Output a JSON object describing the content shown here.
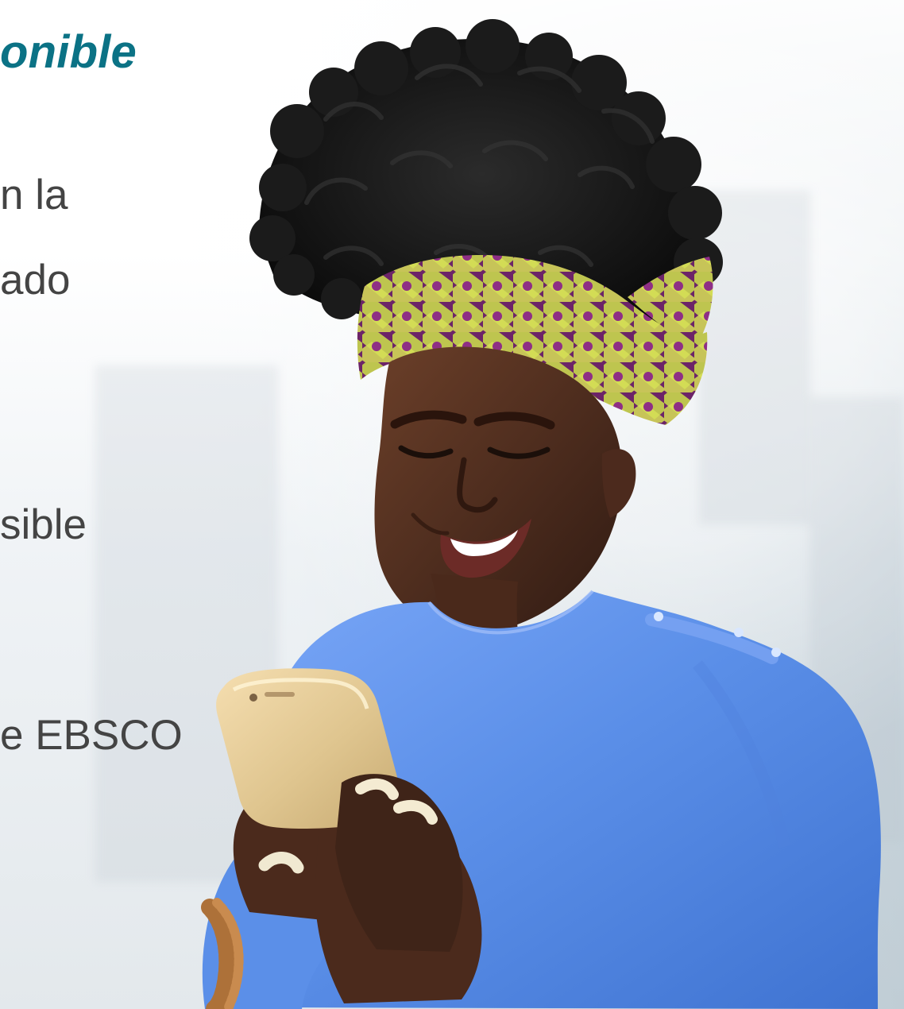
{
  "slide": {
    "title_fragment": "onible",
    "text_fragments": [
      "n la",
      "ado",
      "sible",
      "e EBSCO"
    ]
  },
  "colors": {
    "title": "#0b7285",
    "text": "#444444",
    "background": "#f7fafc",
    "shirt": "#5b8fe8",
    "phone": "#dfc58f",
    "skin": "#5a3422",
    "hair": "#141414",
    "headwrap_purple": "#6c2468",
    "headwrap_yellow": "#c6d34d"
  },
  "image": {
    "subject": "woman smiling and looking at a smartphone"
  }
}
